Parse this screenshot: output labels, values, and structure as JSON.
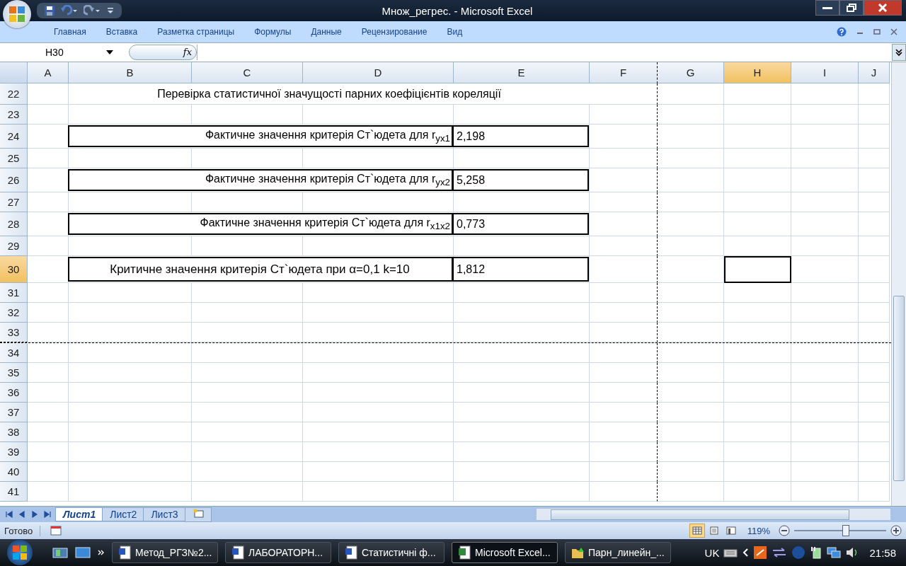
{
  "window": {
    "title": "Множ_регрес. - Microsoft Excel"
  },
  "ribbon_tabs": [
    {
      "label": "Главная"
    },
    {
      "label": "Вставка"
    },
    {
      "label": "Разметка страницы"
    },
    {
      "label": "Формулы"
    },
    {
      "label": "Данные"
    },
    {
      "label": "Рецензирование"
    },
    {
      "label": "Вид"
    }
  ],
  "formula_bar": {
    "name_box": "H30",
    "fx": "fx"
  },
  "columns": [
    {
      "label": "A",
      "selected": false,
      "page_break": false
    },
    {
      "label": "B",
      "selected": false,
      "page_break": false
    },
    {
      "label": "C",
      "selected": false,
      "page_break": false
    },
    {
      "label": "D",
      "selected": false,
      "page_break": false
    },
    {
      "label": "E",
      "selected": false,
      "page_break": false
    },
    {
      "label": "F",
      "selected": false,
      "page_break": true
    },
    {
      "label": "G",
      "selected": false,
      "page_break": false
    },
    {
      "label": "H",
      "selected": true,
      "page_break": false
    },
    {
      "label": "I",
      "selected": false,
      "page_break": false
    },
    {
      "label": "J",
      "selected": false,
      "page_break": false
    }
  ],
  "rows": [
    {
      "number": "22",
      "kind": "title",
      "selected": false,
      "page_break": false,
      "text": "Перевірка статистичної значущості парних коефіцієнтів кореляції"
    },
    {
      "number": "23",
      "kind": "empty",
      "selected": false,
      "page_break": false
    },
    {
      "number": "24",
      "kind": "result",
      "selected": false,
      "page_break": false,
      "label": "Фактичне значення критерія Ст`юдета для r$_{yx1}$",
      "value": "2,198"
    },
    {
      "number": "25",
      "kind": "empty",
      "selected": false,
      "page_break": false
    },
    {
      "number": "26",
      "kind": "result",
      "selected": false,
      "page_break": false,
      "label": "Фактичне значення критерія Ст`юдета для r$_{yx2}$",
      "value": "5,258"
    },
    {
      "number": "27",
      "kind": "empty",
      "selected": false,
      "page_break": false
    },
    {
      "number": "28",
      "kind": "result",
      "selected": false,
      "page_break": false,
      "label": "Фактичне значення критерія Ст`юдета для r$_{x1x2}$",
      "value": "0,773"
    },
    {
      "number": "29",
      "kind": "empty",
      "selected": false,
      "page_break": false
    },
    {
      "number": "30",
      "kind": "critical",
      "selected": true,
      "page_break": false,
      "label": "Критичне значення критерія Ст`юдета при α=0,1 k=10",
      "value": "1,812"
    },
    {
      "number": "31",
      "kind": "empty",
      "selected": false,
      "page_break": false
    },
    {
      "number": "32",
      "kind": "empty",
      "selected": false,
      "page_break": false
    },
    {
      "number": "33",
      "kind": "empty",
      "selected": false,
      "page_break": true
    },
    {
      "number": "34",
      "kind": "empty",
      "selected": false,
      "page_break": false
    },
    {
      "number": "35",
      "kind": "empty",
      "selected": false,
      "page_break": false
    },
    {
      "number": "36",
      "kind": "empty",
      "selected": false,
      "page_break": false
    },
    {
      "number": "37",
      "kind": "empty",
      "selected": false,
      "page_break": false
    },
    {
      "number": "38",
      "kind": "empty",
      "selected": false,
      "page_break": false
    },
    {
      "number": "39",
      "kind": "empty",
      "selected": false,
      "page_break": false
    },
    {
      "number": "40",
      "kind": "empty",
      "selected": false,
      "page_break": false
    },
    {
      "number": "41",
      "kind": "empty",
      "selected": false,
      "page_break": false
    }
  ],
  "sheet_tabs": [
    {
      "label": "Лист1",
      "selected": true
    },
    {
      "label": "Лист2",
      "selected": false
    },
    {
      "label": "Лист3",
      "selected": false
    }
  ],
  "status_bar": {
    "status": "Готово",
    "views": [
      {
        "kind": "normal",
        "selected": true
      },
      {
        "kind": "page-layout",
        "selected": false
      },
      {
        "kind": "page-break",
        "selected": false
      }
    ],
    "zoom": "119%",
    "zoom_slider": {
      "level": 0.55
    }
  },
  "taskbar": {
    "items": [
      {
        "label": "Метод_РГЗ№2...",
        "kind": "word",
        "selected": false
      },
      {
        "label": "ЛАБОРАТОРН...",
        "kind": "word",
        "selected": false
      },
      {
        "label": "Статистичні ф...",
        "kind": "word",
        "selected": false
      },
      {
        "label": "Microsoft Excel...",
        "kind": "excel",
        "selected": true
      },
      {
        "label": "Парн_линейн_...",
        "kind": "folder",
        "selected": false
      }
    ],
    "language": "UK",
    "clock": "21:58"
  }
}
